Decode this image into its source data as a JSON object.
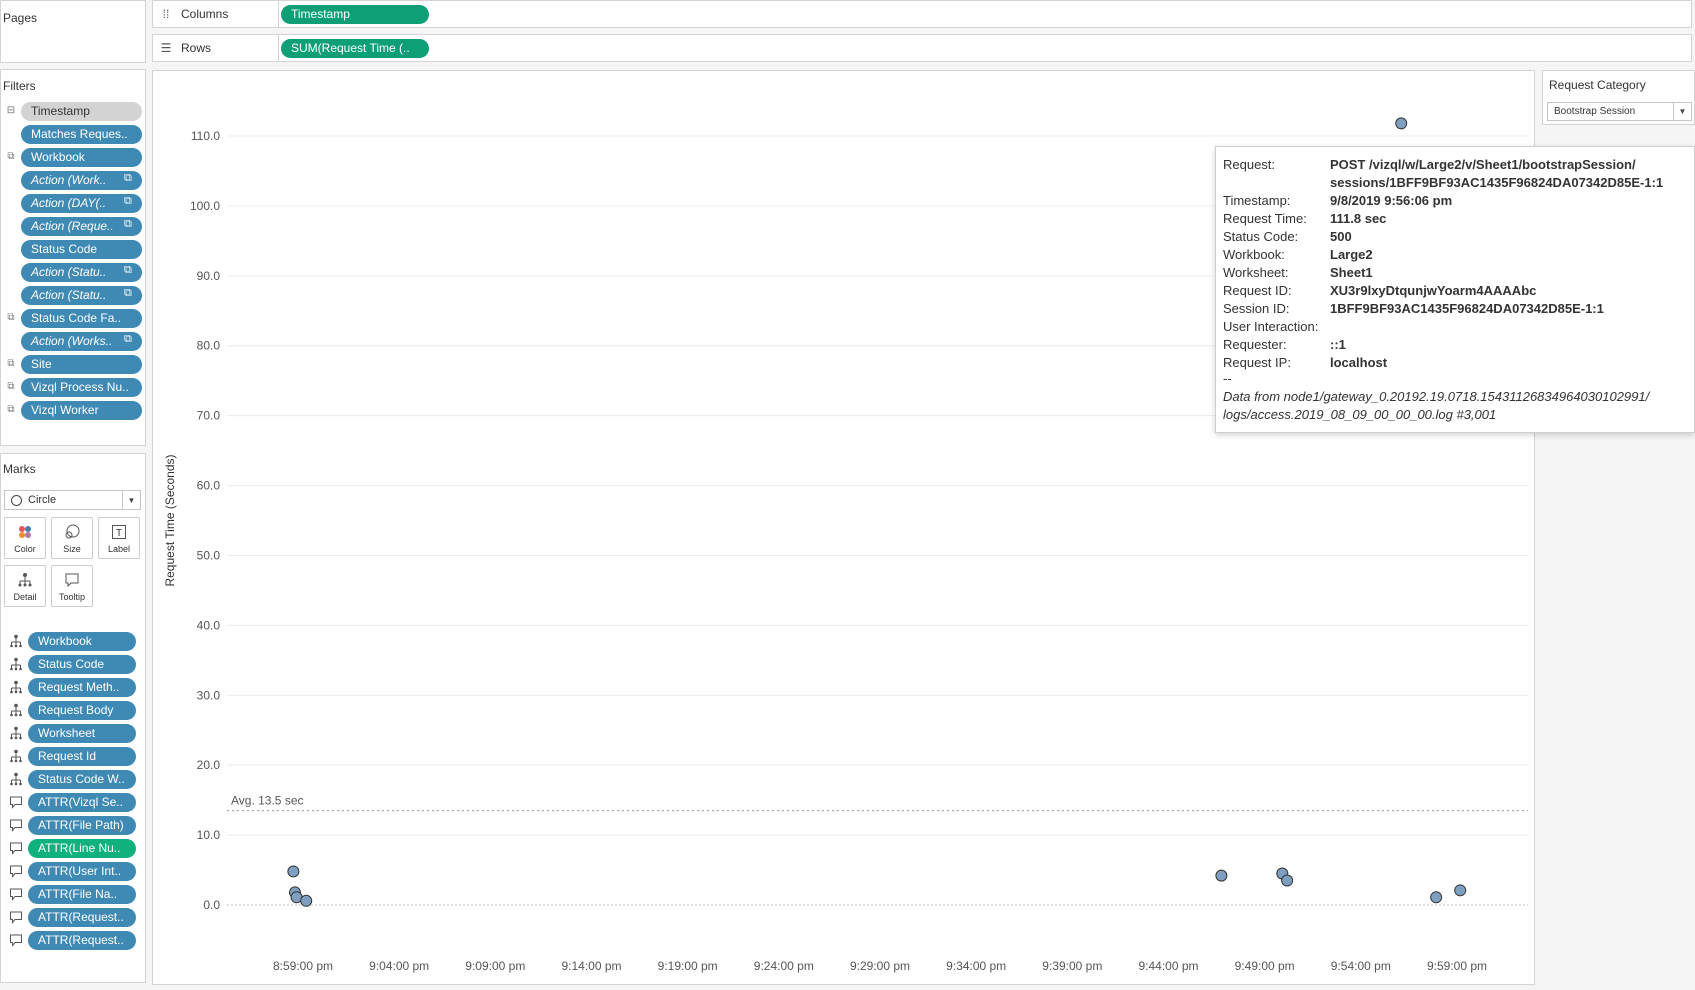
{
  "pages": {
    "title": "Pages"
  },
  "shelves": {
    "columns": {
      "label": "Columns",
      "pill": "Timestamp",
      "pill_color": "#0e9f77"
    },
    "rows": {
      "label": "Rows",
      "pill": "SUM(Request Time (..",
      "pill_color": "#0e9f77"
    }
  },
  "filters": {
    "title": "Filters",
    "items": [
      {
        "label": "Timestamp",
        "style": "gray",
        "icon": "collapse-icon"
      },
      {
        "label": "Matches Reques..",
        "style": "blue"
      },
      {
        "label": "Workbook",
        "style": "blue",
        "icon": "set-icon"
      },
      {
        "label": "Action (Work..",
        "style": "blue-italic-link"
      },
      {
        "label": "Action (DAY(..",
        "style": "blue-italic-link"
      },
      {
        "label": "Action (Reque..",
        "style": "blue-italic-link"
      },
      {
        "label": "Status Code",
        "style": "blue"
      },
      {
        "label": "Action (Statu..",
        "style": "blue-italic-link"
      },
      {
        "label": "Action (Statu..",
        "style": "blue-italic-link"
      },
      {
        "label": "Status Code Fa..",
        "style": "blue",
        "icon": "set-icon"
      },
      {
        "label": "Action (Works..",
        "style": "blue-italic-link"
      },
      {
        "label": "Site",
        "style": "blue",
        "icon": "set-icon"
      },
      {
        "label": "Vizql Process Nu..",
        "style": "blue",
        "icon": "set-icon"
      },
      {
        "label": "Vizql Worker",
        "style": "blue",
        "icon": "set-icon"
      }
    ]
  },
  "marks": {
    "title": "Marks",
    "mark_type": "Circle",
    "buttons": [
      "Color",
      "Size",
      "Label",
      "Detail",
      "Tooltip"
    ],
    "fields": [
      {
        "label": "Workbook",
        "kind": "detail",
        "color": "blue"
      },
      {
        "label": "Status Code",
        "kind": "detail",
        "color": "blue"
      },
      {
        "label": "Request Meth..",
        "kind": "detail",
        "color": "blue"
      },
      {
        "label": "Request Body",
        "kind": "detail",
        "color": "blue"
      },
      {
        "label": "Worksheet",
        "kind": "detail",
        "color": "blue"
      },
      {
        "label": "Request Id",
        "kind": "detail",
        "color": "blue"
      },
      {
        "label": "Status Code W..",
        "kind": "detail",
        "color": "blue"
      },
      {
        "label": "ATTR(Vizql Se..",
        "kind": "tooltip",
        "color": "blue"
      },
      {
        "label": "ATTR(File Path)",
        "kind": "tooltip",
        "color": "blue"
      },
      {
        "label": "ATTR(Line Nu..",
        "kind": "tooltip",
        "color": "green"
      },
      {
        "label": "ATTR(User Int..",
        "kind": "tooltip",
        "color": "blue"
      },
      {
        "label": "ATTR(File Na..",
        "kind": "tooltip",
        "color": "blue"
      },
      {
        "label": "ATTR(Request..",
        "kind": "tooltip",
        "color": "blue"
      },
      {
        "label": "ATTR(Request..",
        "kind": "tooltip",
        "color": "blue"
      }
    ]
  },
  "request_category": {
    "title": "Request Category",
    "selected": "Bootstrap Session"
  },
  "chart_data": {
    "type": "scatter",
    "ylabel": "Request Time (Seconds)",
    "xlabel": "",
    "ylim": [
      -6,
      118
    ],
    "yticks": [
      "0.0",
      "10.0",
      "20.0",
      "30.0",
      "40.0",
      "50.0",
      "60.0",
      "70.0",
      "80.0",
      "90.0",
      "100.0",
      "110.0"
    ],
    "xticks": [
      "8:59:00 pm",
      "9:04:00 pm",
      "9:09:00 pm",
      "9:14:00 pm",
      "9:19:00 pm",
      "9:24:00 pm",
      "9:29:00 pm",
      "9:34:00 pm",
      "9:39:00 pm",
      "9:44:00 pm",
      "9:49:00 pm",
      "9:54:00 pm",
      "9:59:00 pm"
    ],
    "reference_line": {
      "label": "Avg. 13.5 sec",
      "value": 13.5
    },
    "grid": true,
    "marker_color": "#7f9fc1",
    "points": [
      {
        "x": "8:58:30 pm",
        "y": 4.8
      },
      {
        "x": "8:58:35 pm",
        "y": 1.8
      },
      {
        "x": "8:58:40 pm",
        "y": 1.1
      },
      {
        "x": "8:59:10 pm",
        "y": 0.6
      },
      {
        "x": "9:46:45 pm",
        "y": 4.2
      },
      {
        "x": "9:49:55 pm",
        "y": 4.5
      },
      {
        "x": "9:50:10 pm",
        "y": 3.5
      },
      {
        "x": "9:56:06 pm",
        "y": 111.8
      },
      {
        "x": "9:57:55 pm",
        "y": 1.1
      },
      {
        "x": "9:59:10 pm",
        "y": 2.1
      }
    ]
  },
  "tooltip": {
    "rows": [
      {
        "key": "Request:",
        "value": "POST /vizql/w/Large2/v/Sheet1/bootstrapSession/"
      },
      {
        "key": "",
        "value": "sessions/1BFF9BF93AC1435F96824DA07342D85E-1:1"
      },
      {
        "key": "Timestamp:",
        "value": "9/8/2019 9:56:06 pm"
      },
      {
        "key": "Request Time:",
        "value": "111.8 sec"
      },
      {
        "key": "Status Code:",
        "value": "500"
      },
      {
        "key": "Workbook:",
        "value": "Large2"
      },
      {
        "key": "Worksheet:",
        "value": "Sheet1"
      },
      {
        "key": "Request ID:",
        "value": "XU3r9lxyDtqunjwYoarm4AAAAbc"
      },
      {
        "key": "Session ID:",
        "value": "1BFF9BF93AC1435F96824DA07342D85E-1:1"
      },
      {
        "key": "User Interaction:",
        "value": ""
      },
      {
        "key": "Requester:",
        "value": " ::1"
      },
      {
        "key": "Request IP:",
        "value": "localhost"
      }
    ],
    "separator": "--",
    "note_line1": "Data from node1/gateway_0.20192.19.0718.15431126834964030102991/",
    "note_line2": "logs/access.2019_08_09_00_00_00.log #3,001"
  }
}
